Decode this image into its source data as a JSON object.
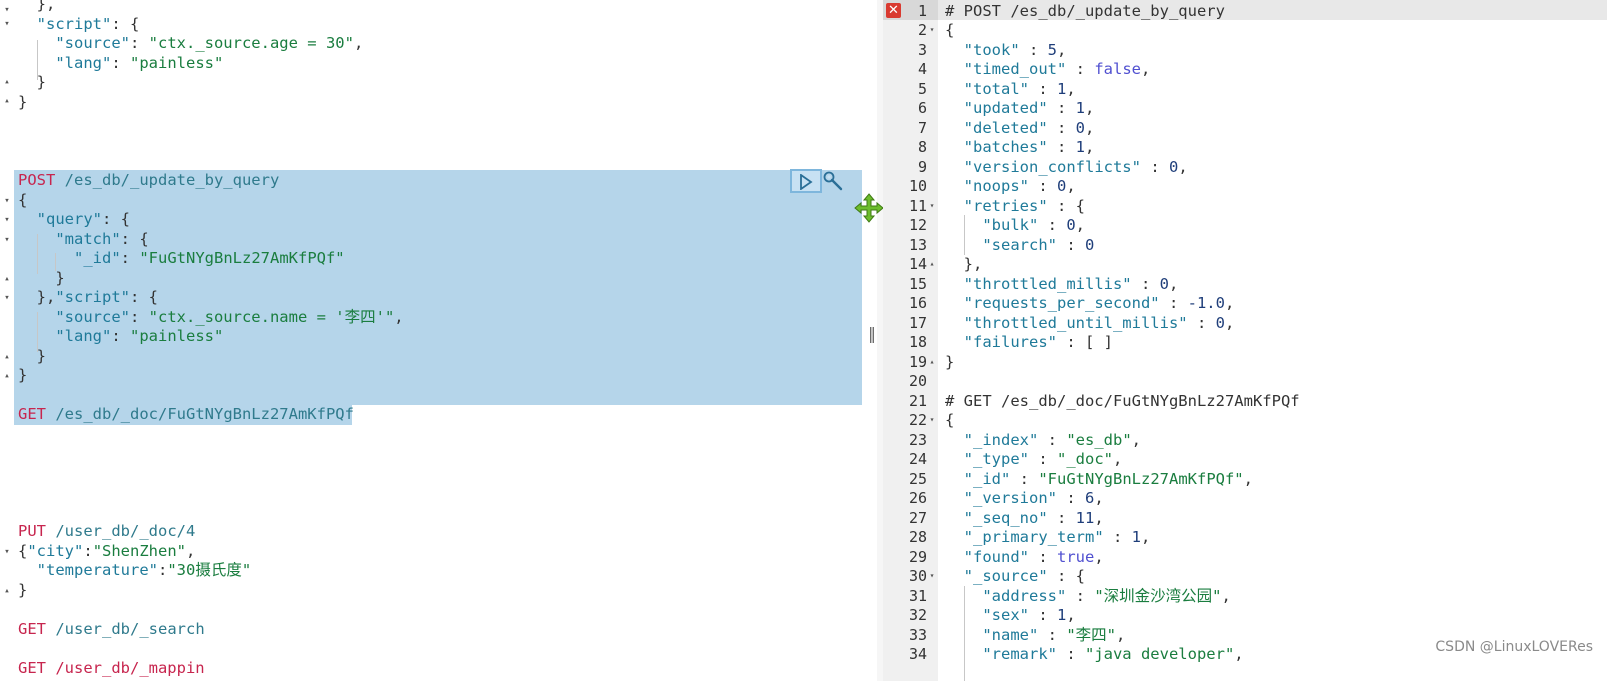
{
  "left_editor": {
    "block1": {
      "close_prev": "},",
      "script_key": "\"script\"",
      "source_key": "\"source\"",
      "source_val": "\"ctx._source.age = 30\"",
      "lang_key": "\"lang\"",
      "lang_val": "\"painless\""
    },
    "request1": {
      "method": "POST",
      "url": "/es_db/_update_by_query",
      "query_key": "\"query\"",
      "match_key": "\"match\"",
      "id_key": "\"_id\"",
      "id_val": "\"FuGtNYgBnLz27AmKfPQf\"",
      "script_key": "\"script\"",
      "source_key": "\"source\"",
      "source_val": "\"ctx._source.name = '李四'\"",
      "lang_key": "\"lang\"",
      "lang_val": "\"painless\""
    },
    "request2": {
      "method": "GET",
      "url": "/es_db/_doc/FuGtNYgBnLz27AmKfPQf"
    },
    "request3": {
      "method": "PUT",
      "url": "/user_db/_doc/4",
      "city_key": "\"city\"",
      "city_val": "\"ShenZhen\"",
      "temp_key": "\"temperature\"",
      "temp_val": "\"30摄氏度\""
    },
    "request4": {
      "method": "GET",
      "url": "/user_db/_search"
    },
    "request5": {
      "partial": "GET /user_db/_mappin"
    }
  },
  "right_output": {
    "line_numbers": [
      "1",
      "2",
      "3",
      "4",
      "5",
      "6",
      "7",
      "8",
      "9",
      "10",
      "11",
      "12",
      "13",
      "14",
      "15",
      "16",
      "17",
      "18",
      "19",
      "20",
      "21",
      "22",
      "23",
      "24",
      "25",
      "26",
      "27",
      "28",
      "29",
      "30",
      "31",
      "32",
      "33",
      "34"
    ],
    "comment1": "# POST /es_db/_update_by_query",
    "took": "5",
    "timed_out": "false",
    "total": "1",
    "updated": "1",
    "deleted": "0",
    "batches": "1",
    "version_conflicts": "0",
    "noops": "0",
    "bulk": "0",
    "search": "0",
    "throttled_millis": "0",
    "requests_per_second": "-1.0",
    "throttled_until_millis": "0",
    "failures": "[ ]",
    "comment2": "# GET /es_db/_doc/FuGtNYgBnLz27AmKfPQf",
    "_index": "\"es_db\"",
    "_type": "\"_doc\"",
    "_id": "\"FuGtNYgBnLz27AmKfPQf\"",
    "_version": "6",
    "_seq_no": "11",
    "_primary_term": "1",
    "found": "true",
    "address": "\"深圳金沙湾公园\"",
    "sex": "1",
    "name": "\"李四\"",
    "remark": "\"java developer\""
  },
  "watermark": "CSDN @LinuxLOVERes"
}
